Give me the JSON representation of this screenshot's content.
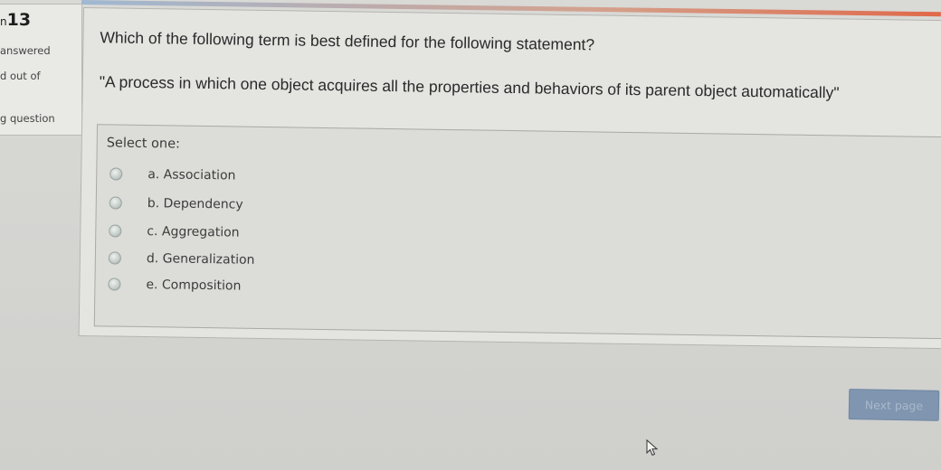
{
  "info": {
    "question_number_prefix": "n",
    "question_number": "13",
    "status": "answered",
    "marks": "d out of",
    "flag": "g question"
  },
  "question": {
    "text": "Which of the following term is best defined for the following statement?",
    "statement": "\"A process in which one object acquires all the properties and behaviors of its parent object automatically\""
  },
  "answer": {
    "prompt": "Select one:",
    "options": [
      {
        "label": "a. Association"
      },
      {
        "label": "b. Dependency"
      },
      {
        "label": "c. Aggregation"
      },
      {
        "label": "d. Generalization"
      },
      {
        "label": "e. Composition"
      }
    ]
  },
  "navigation": {
    "next_label": "Next page"
  },
  "colors": {
    "accent": "#e0694a",
    "button": "#7f95b0"
  },
  "icons": {
    "cursor": "arrow-cursor-icon",
    "radio": "radio-button-icon"
  }
}
